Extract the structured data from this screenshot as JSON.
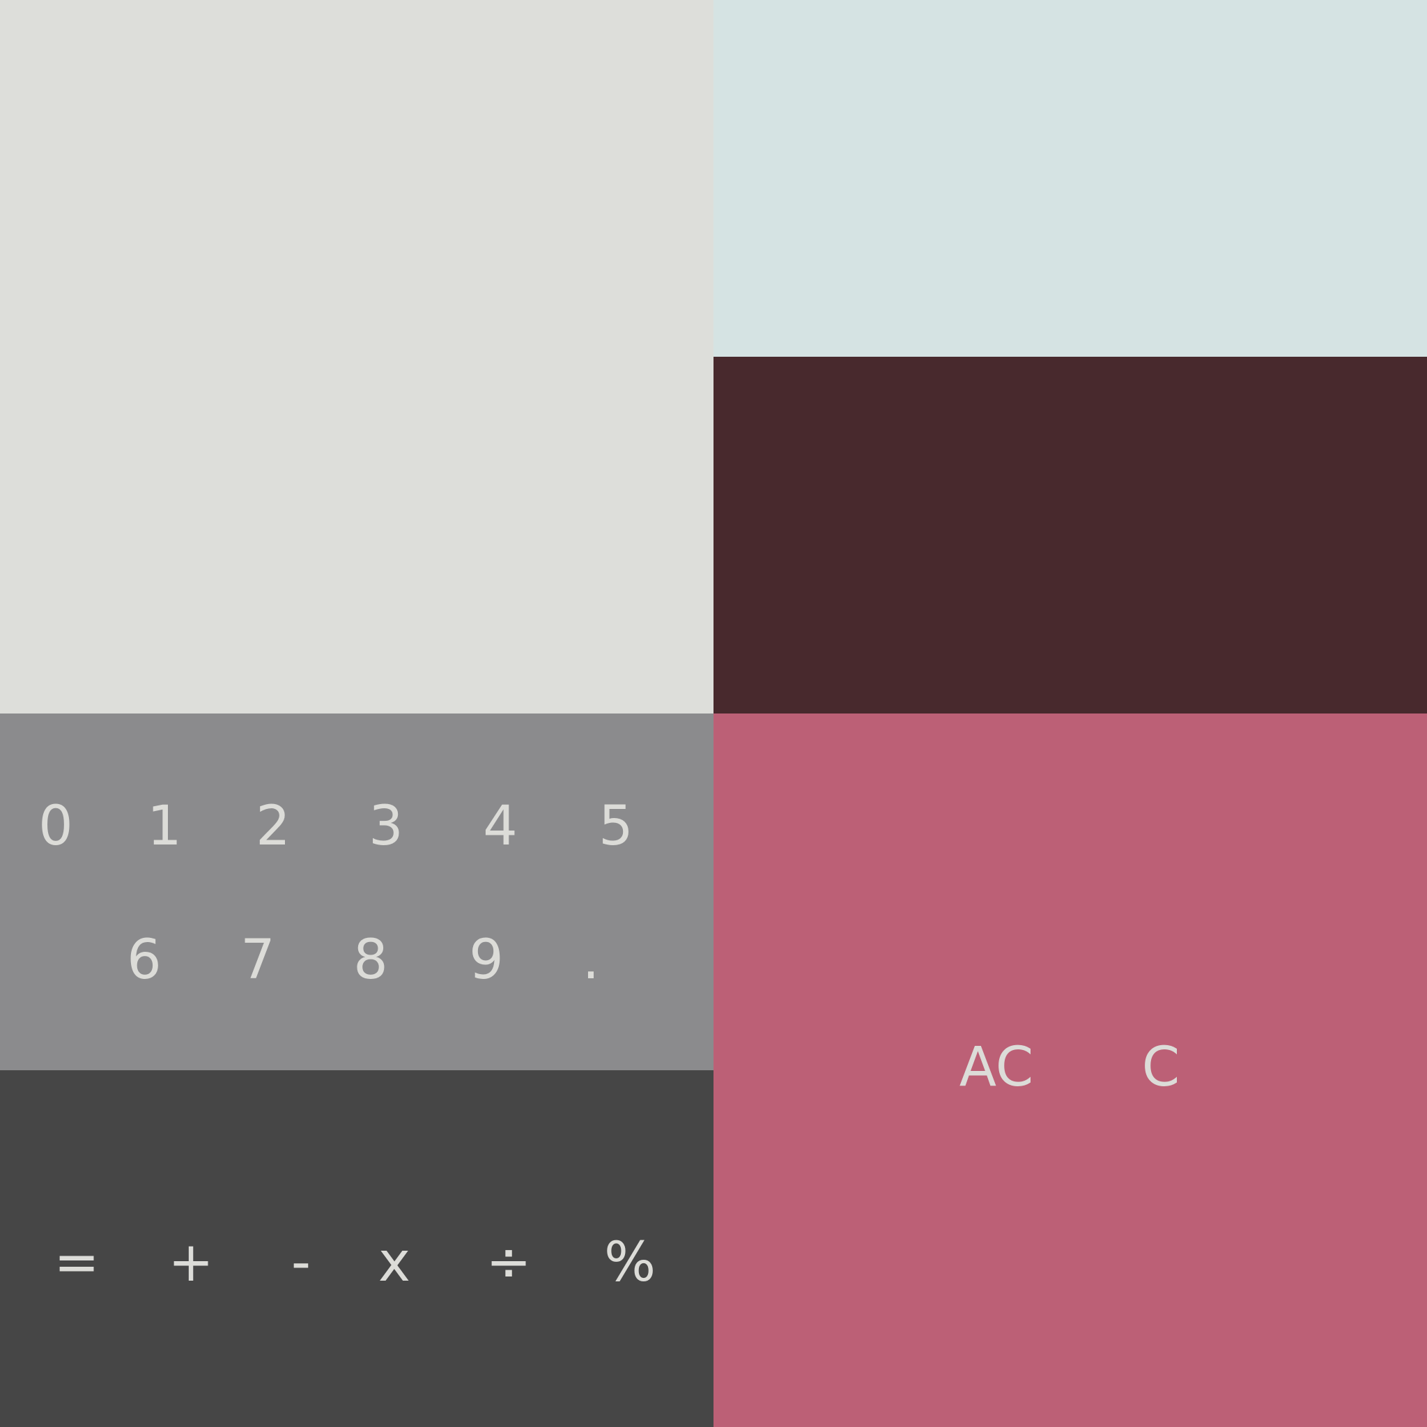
{
  "colors": {
    "display_bg": "#dddeda",
    "top_right_bg": "#d5e3e3",
    "mid_right_bg": "#48292d",
    "digits_bg": "#8b8b8d",
    "operators_bg": "#464646",
    "clear_bg": "#bc6076",
    "key_text": "#dcdcd8"
  },
  "display": {
    "value": ""
  },
  "digit_keys": [
    "0",
    "1",
    "2",
    "3",
    "4",
    "5",
    "6",
    "7",
    "8",
    "9",
    "."
  ],
  "operator_keys": [
    "=",
    "+",
    "-",
    "x",
    "÷",
    "%"
  ],
  "clear_keys": [
    "AC",
    "C"
  ]
}
